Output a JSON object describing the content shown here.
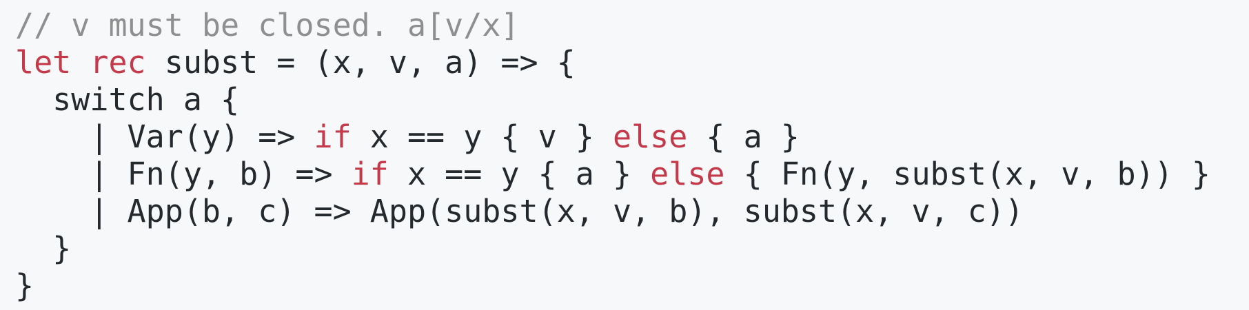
{
  "colors": {
    "background": "#f6f8fa",
    "text": "#24292e",
    "keyword": "#c53a4a",
    "comment": "#8f8f8f"
  },
  "code": {
    "lines": [
      [
        {
          "text": "// v must be closed. a[v/x]",
          "kind": "comment"
        }
      ],
      [
        {
          "text": "let",
          "kind": "keyword"
        },
        {
          "text": " ",
          "kind": "plain"
        },
        {
          "text": "rec",
          "kind": "keyword"
        },
        {
          "text": " subst = (x, v, a) => {",
          "kind": "plain"
        }
      ],
      [
        {
          "text": "  switch a {",
          "kind": "plain"
        }
      ],
      [
        {
          "text": "    | Var(y) => ",
          "kind": "plain"
        },
        {
          "text": "if",
          "kind": "keyword"
        },
        {
          "text": " x == y { v } ",
          "kind": "plain"
        },
        {
          "text": "else",
          "kind": "keyword"
        },
        {
          "text": " { a }",
          "kind": "plain"
        }
      ],
      [
        {
          "text": "    | Fn(y, b) => ",
          "kind": "plain"
        },
        {
          "text": "if",
          "kind": "keyword"
        },
        {
          "text": " x == y { a } ",
          "kind": "plain"
        },
        {
          "text": "else",
          "kind": "keyword"
        },
        {
          "text": " { Fn(y, subst(x, v, b)) }",
          "kind": "plain"
        }
      ],
      [
        {
          "text": "    | App(b, c) => App(subst(x, v, b), subst(x, v, c))",
          "kind": "plain"
        }
      ],
      [
        {
          "text": "  }",
          "kind": "plain"
        }
      ],
      [
        {
          "text": "}",
          "kind": "plain"
        }
      ]
    ]
  }
}
